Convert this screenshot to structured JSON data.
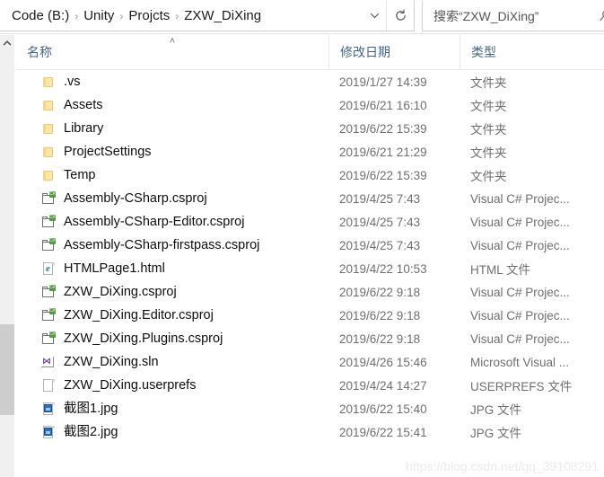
{
  "window": {
    "title": "ZXW_DiXing"
  },
  "address_bar": {
    "breadcrumbs": [
      {
        "label": "Code (B:)"
      },
      {
        "label": "Unity"
      },
      {
        "label": "Projcts"
      },
      {
        "label": "ZXW_DiXing"
      }
    ],
    "separator": "›",
    "dropdown_icon": "chevron-down-icon",
    "refresh_icon": "refresh-icon"
  },
  "search": {
    "placeholder": "搜索“ZXW_DiXing”",
    "value": "",
    "icon": "search-icon"
  },
  "scrollbar": {
    "up_arrow_icon": "chevron-up-icon"
  },
  "columns": {
    "name": "名称",
    "date_modified": "修改日期",
    "type": "类型",
    "sort_caret": "˄"
  },
  "files": [
    {
      "name": ".vs",
      "date": "2019/1/27 14:39",
      "type": "文件夹",
      "icon": "folder-icon"
    },
    {
      "name": "Assets",
      "date": "2019/6/21 16:10",
      "type": "文件夹",
      "icon": "folder-icon"
    },
    {
      "name": "Library",
      "date": "2019/6/22 15:39",
      "type": "文件夹",
      "icon": "folder-icon"
    },
    {
      "name": "ProjectSettings",
      "date": "2019/6/21 21:29",
      "type": "文件夹",
      "icon": "folder-icon"
    },
    {
      "name": "Temp",
      "date": "2019/6/22 15:39",
      "type": "文件夹",
      "icon": "folder-icon"
    },
    {
      "name": "Assembly-CSharp.csproj",
      "date": "2019/4/25 7:43",
      "type": "Visual C# Projec...",
      "icon": "csproj-icon"
    },
    {
      "name": "Assembly-CSharp-Editor.csproj",
      "date": "2019/4/25 7:43",
      "type": "Visual C# Projec...",
      "icon": "csproj-icon"
    },
    {
      "name": "Assembly-CSharp-firstpass.csproj",
      "date": "2019/4/25 7:43",
      "type": "Visual C# Projec...",
      "icon": "csproj-icon"
    },
    {
      "name": "HTMLPage1.html",
      "date": "2019/4/22 10:53",
      "type": "HTML 文件",
      "icon": "html-icon"
    },
    {
      "name": "ZXW_DiXing.csproj",
      "date": "2019/6/22 9:18",
      "type": "Visual C# Projec...",
      "icon": "csproj-icon"
    },
    {
      "name": "ZXW_DiXing.Editor.csproj",
      "date": "2019/6/22 9:18",
      "type": "Visual C# Projec...",
      "icon": "csproj-icon"
    },
    {
      "name": "ZXW_DiXing.Plugins.csproj",
      "date": "2019/6/22 9:18",
      "type": "Visual C# Projec...",
      "icon": "csproj-icon"
    },
    {
      "name": "ZXW_DiXing.sln",
      "date": "2019/4/26 15:46",
      "type": "Microsoft Visual ...",
      "icon": "sln-icon"
    },
    {
      "name": "ZXW_DiXing.userprefs",
      "date": "2019/4/24 14:27",
      "type": "USERPREFS 文件",
      "icon": "blank-document-icon"
    },
    {
      "name": "截图1.jpg",
      "date": "2019/6/22 15:40",
      "type": "JPG 文件",
      "icon": "jpg-icon"
    },
    {
      "name": "截图2.jpg",
      "date": "2019/6/22 15:41",
      "type": "JPG 文件",
      "icon": "jpg-icon"
    }
  ],
  "watermark": "https://blog.csdn.net/qq_39108291",
  "colors": {
    "header_text": "#41658a",
    "row_text": "#0d0d0d",
    "secondary_text": "#6f6f6f",
    "folder_fill": "#fbe6a8",
    "csharp_badge": "#4f9c3f",
    "sln_purple": "#7b4aa0",
    "jpg_blue": "#2f6fbf",
    "scroll_thumb": "#cdcdcd",
    "watermark": "#ebebeb"
  }
}
